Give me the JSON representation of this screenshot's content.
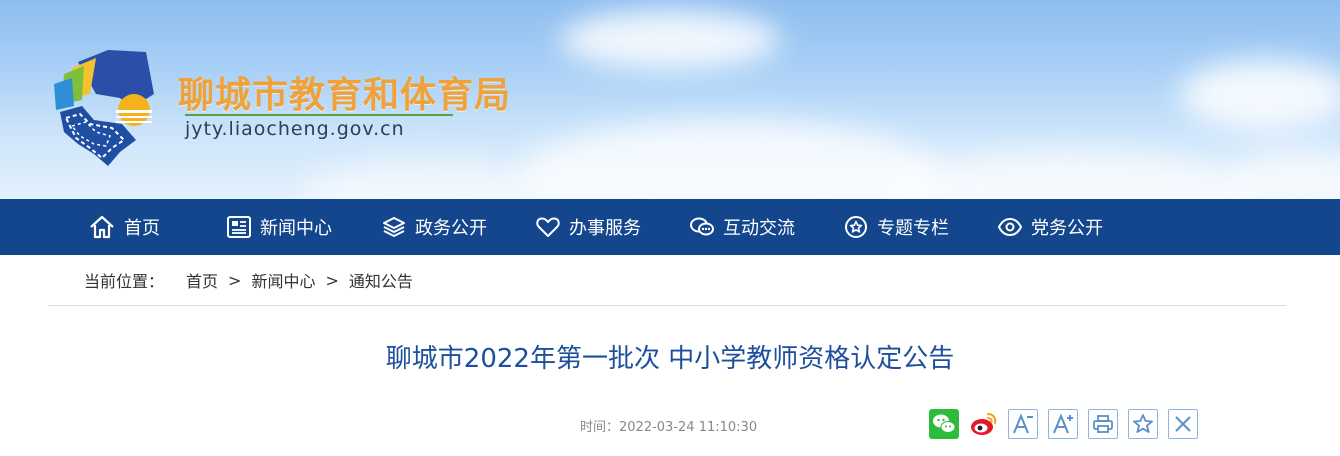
{
  "header": {
    "site_title": "聊城市教育和体育局",
    "site_domain": "jyty.liaocheng.gov.cn"
  },
  "nav": {
    "items": [
      {
        "label": "首页",
        "icon": "home-icon"
      },
      {
        "label": "新闻中心",
        "icon": "newspaper-icon"
      },
      {
        "label": "政务公开",
        "icon": "layers-icon"
      },
      {
        "label": "办事服务",
        "icon": "heart-icon"
      },
      {
        "label": "互动交流",
        "icon": "chat-icon"
      },
      {
        "label": "专题专栏",
        "icon": "star-circle-icon"
      },
      {
        "label": "党务公开",
        "icon": "eye-icon"
      }
    ]
  },
  "breadcrumb": {
    "label": "当前位置：",
    "items": [
      "首页",
      "新闻中心",
      "通知公告"
    ],
    "separator": ">"
  },
  "article": {
    "title": "聊城市2022年第一批次 中小学教师资格认定公告",
    "time_label": "时间：",
    "time_value": "2022-03-24 11:10:30"
  },
  "toolbar": {
    "font_decrease": "A",
    "font_increase": "A",
    "tools": [
      "wechat-share-icon",
      "weibo-share-icon",
      "font-decrease-icon",
      "font-increase-icon",
      "print-icon",
      "favorite-icon",
      "close-icon"
    ]
  },
  "colors": {
    "nav_bg": "#14468e",
    "title_orange": "#f0a23a",
    "article_title": "#1e4f9c",
    "wechat_green": "#2dbb3a",
    "weibo_red": "#e6162d"
  }
}
